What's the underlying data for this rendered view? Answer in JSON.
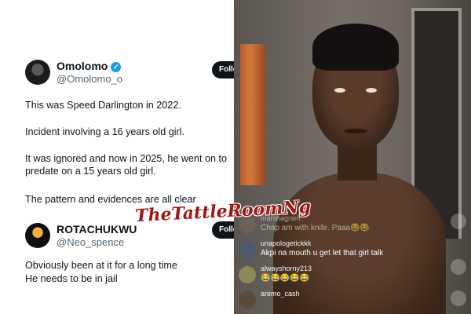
{
  "tweet1": {
    "name": "Omolomo",
    "verified_glyph": "✓",
    "handle": "@Omolomo_o",
    "follow_label": "Follo",
    "paragraphs": [
      "This was Speed Darlington in 2022.",
      "Incident involving a 16 years old girl.",
      "It was ignored and now in 2025, he went on to predate on a 15 years old girl.",
      "The pattern and evidences are all clear"
    ]
  },
  "tweet2": {
    "name": "ROTACHUKWU",
    "handle": "@Neo_spence",
    "follow_label": "Follo",
    "lines": [
      "Obviously been at it for a long time",
      "He needs to be in jail"
    ]
  },
  "watermark": "TheTattleRoomNg",
  "live_comments": [
    {
      "user": "marshagram",
      "text": "Chap am with knife. Paaa😂😂",
      "avatar_color": "#7a6a5a"
    },
    {
      "user": "unapologetickkk",
      "text": "Akpi na mouth u get let that girl talk",
      "avatar_color": "#4a5a6a"
    },
    {
      "user": "alwayshorny213",
      "text": "😂😂😂😂😂",
      "avatar_color": "#8a8a5a"
    },
    {
      "user": "aremo_cash",
      "text": "",
      "avatar_color": "#5a4a3a"
    }
  ]
}
